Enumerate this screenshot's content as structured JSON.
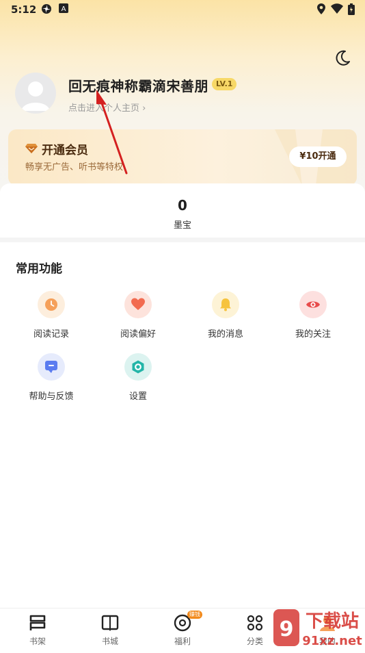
{
  "status_bar": {
    "time": "5:12",
    "left_icons": [
      "pinwheel-icon",
      "a-box-icon"
    ],
    "right_icons": [
      "location-icon",
      "wifi-icon",
      "battery-icon"
    ]
  },
  "header": {
    "theme_toggle_icon": "moon-icon"
  },
  "profile": {
    "username": "回无痕神称霸滴宋善朋",
    "level": "LV.1",
    "link_text": "点击进入个人主页 ›"
  },
  "vip": {
    "title": "开通会员",
    "subtitle": "畅享无广告、听书等特权",
    "button_label": "¥10开通",
    "icon": "diamond-icon"
  },
  "stats": {
    "mobao_value": "0",
    "mobao_label": "墨宝"
  },
  "functions": {
    "title": "常用功能",
    "items": [
      {
        "label": "阅读记录",
        "icon": "clock-icon",
        "color": "#f5a05a"
      },
      {
        "label": "阅读偏好",
        "icon": "heart-icon",
        "color": "#f26b50"
      },
      {
        "label": "我的消息",
        "icon": "bell-icon",
        "color": "#f6c33d"
      },
      {
        "label": "我的关注",
        "icon": "eye-icon",
        "color": "#e84c4c"
      },
      {
        "label": "帮助与反馈",
        "icon": "chat-icon",
        "color": "#5b7cf0"
      },
      {
        "label": "设置",
        "icon": "hexagon-gear-icon",
        "color": "#23b5a8"
      }
    ]
  },
  "bottom_nav": {
    "items": [
      {
        "label": "书架",
        "icon": "bookshelf-icon"
      },
      {
        "label": "书城",
        "icon": "book-icon"
      },
      {
        "label": "福利",
        "icon": "coin-icon",
        "badge": "赚钱"
      },
      {
        "label": "分类",
        "icon": "grid-icon"
      },
      {
        "label": "我的",
        "icon": "person-icon"
      }
    ]
  },
  "watermark": {
    "text_top": "下载站",
    "text_bottom": "91xz.net"
  },
  "colors": {
    "accent_orange": "#f5a05a",
    "vip_brown": "#4a2b0f",
    "annotation_red": "#d42020"
  }
}
